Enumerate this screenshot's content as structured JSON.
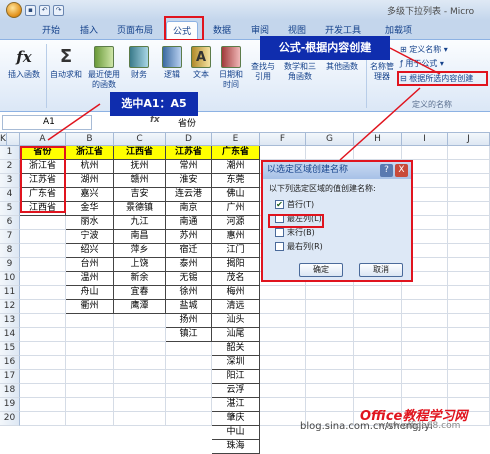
{
  "window": {
    "title": "多级下拉列表 - Micro"
  },
  "tabs": [
    "开始",
    "插入",
    "页面布局",
    "公式",
    "数据",
    "审阅",
    "视图",
    "开发工具",
    "加载项"
  ],
  "active_tab": "公式",
  "ribbon": {
    "insert_function": "插入函数",
    "autosum": "自动求和",
    "recent": "最近使用的函数",
    "financial": "财务",
    "logical": "逻辑",
    "text": "文本",
    "datetime": "日期和时间",
    "lookup": "查找与引用",
    "math": "数学和三角函数",
    "other": "其他函数",
    "name_manager": "名称管理器",
    "define_name": "定义名称",
    "use_in_formula": "用于公式",
    "create_from_selection": "根据所选内容创建",
    "group_defined_names": "定义的名称"
  },
  "callouts": {
    "top": "公式-根据内容创建",
    "select": "选中A1：A5"
  },
  "formula_bar": {
    "name_box": "A1",
    "fx": "fx",
    "value": "省份"
  },
  "grid": {
    "columns": [
      "A",
      "B",
      "C",
      "D",
      "E",
      "F",
      "G",
      "H",
      "I",
      "J",
      "K"
    ],
    "rows": [
      "1",
      "2",
      "3",
      "4",
      "5",
      "6",
      "7",
      "8",
      "9",
      "10",
      "11",
      "12",
      "13",
      "14",
      "15",
      "16",
      "17",
      "18",
      "19",
      "20"
    ],
    "colA": [
      "省份",
      "浙江省",
      "江苏省",
      "广东省",
      "江西省"
    ],
    "headers": [
      "浙江省",
      "江西省",
      "江苏省",
      "广东省"
    ],
    "colB": [
      "杭州",
      "湖州",
      "嘉兴",
      "金华",
      "丽水",
      "宁波",
      "绍兴",
      "台州",
      "温州",
      "舟山",
      "衢州"
    ],
    "colC": [
      "抚州",
      "赣州",
      "吉安",
      "景德镇",
      "九江",
      "南昌",
      "萍乡",
      "上饶",
      "新余",
      "宜春",
      "鹰潭"
    ],
    "colD": [
      "常州",
      "淮安",
      "连云港",
      "南京",
      "南通",
      "苏州",
      "宿迁",
      "泰州",
      "无锡",
      "徐州",
      "盐城",
      "扬州",
      "镇江"
    ],
    "colE": [
      "潮州",
      "东莞",
      "佛山",
      "广州",
      "河源",
      "惠州",
      "江门",
      "揭阳",
      "茂名",
      "梅州",
      "清远",
      "汕头",
      "汕尾",
      "韶关",
      "深圳",
      "阳江",
      "云浮",
      "湛江",
      "肇庆",
      "中山",
      "珠海"
    ]
  },
  "dialog": {
    "title": "以选定区域创建名称",
    "help": "?",
    "close": "X",
    "prompt": "以下列选定区域的值创建名称:",
    "options": [
      {
        "label": "首行(T)",
        "checked": true
      },
      {
        "label": "最左列(L)",
        "checked": false
      },
      {
        "label": "末行(B)",
        "checked": false
      },
      {
        "label": "最右列(R)",
        "checked": false
      }
    ],
    "ok": "确定",
    "cancel": "取消"
  },
  "watermark": {
    "blog": "blog.sina.com.cn/shengjiyi",
    "office": "Office教程学习网",
    "url": "www.office68.com"
  },
  "colors": {
    "accent_red": "#e0141e",
    "callout_blue": "#0f2dae",
    "header_yellow": "#ffff00"
  }
}
